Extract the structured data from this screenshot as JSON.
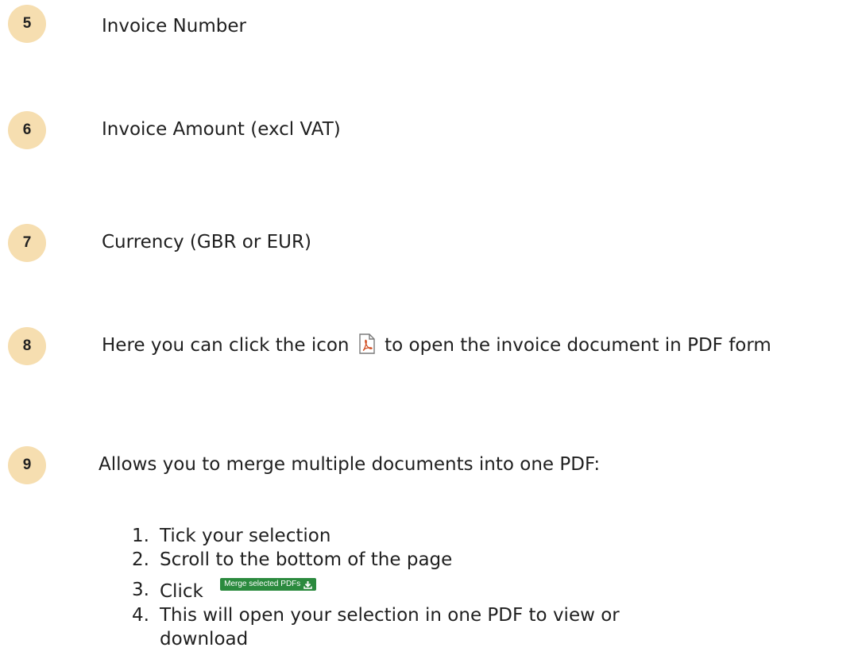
{
  "items": [
    {
      "number": "5",
      "text": "Invoice Number"
    },
    {
      "number": "6",
      "text": "Invoice Amount (excl VAT)"
    },
    {
      "number": "7",
      "text": "Currency (GBR or EUR)"
    },
    {
      "number": "8",
      "text_before": "Here you can click the icon",
      "icon": "pdf-file-icon",
      "text_after": "to open the invoice document in PDF form"
    },
    {
      "number": "9",
      "text": "Allows you to merge multiple documents into one PDF:"
    }
  ],
  "steps": [
    {
      "num": "1.",
      "text": "Tick your selection"
    },
    {
      "num": "2.",
      "text": "Scroll to the bottom of the page"
    },
    {
      "num": "3.",
      "text": "Click",
      "button_label": "Merge selected PDFs",
      "button_icon": "download-icon"
    },
    {
      "num": "4.",
      "text": "This will open your selection in one PDF to view or download"
    }
  ],
  "colors": {
    "badge": "#f6deb0",
    "merge_button": "#2b8a3e"
  }
}
